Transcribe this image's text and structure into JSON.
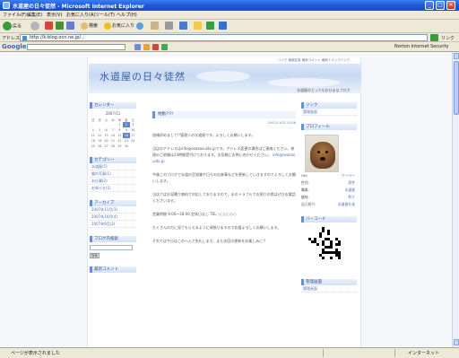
{
  "window": {
    "title": "水道屋の日々徒然 - Microsoft Internet Explorer"
  },
  "menu": [
    "ファイル(F)",
    "編集(E)",
    "表示(V)",
    "お気に入り(A)",
    "ツール(T)",
    "ヘルプ(H)"
  ],
  "toolbar": {
    "back": "戻る",
    "search": "検索",
    "favorites": "お気に入り"
  },
  "address": {
    "label": "アドレス(D)",
    "url": "http://k-blog.ocn.ne.jp/...",
    "links": "リンク"
  },
  "googlebar": {
    "logo": "Google",
    "norton": "Norton Internet Security"
  },
  "blog": {
    "title": "水道屋の日々徒然",
    "tagline": "水道屋のとってもおひまなブログ",
    "header_links": "リンク 最新記事 最新コメント 最新トラックバック",
    "left": {
      "calendar_heading": "カレンダー",
      "calendar_month": "2007/11",
      "calendar_weekdays": [
        "日",
        "月",
        "火",
        "水",
        "木",
        "金",
        "土"
      ],
      "calendar_rows": [
        [
          "",
          "",
          "",
          "",
          "1",
          "2",
          "3"
        ],
        [
          "4",
          "5",
          "6",
          "7",
          "8",
          "9",
          "10"
        ],
        [
          "11",
          "12",
          "13",
          "14",
          "15",
          "16",
          "17"
        ],
        [
          "18",
          "19",
          "20",
          "21",
          "22",
          "23",
          "24"
        ],
        [
          "25",
          "26",
          "27",
          "28",
          "29",
          "30",
          ""
        ]
      ],
      "categories_heading": "カテゴリー",
      "categories": [
        "水道屋(5)",
        "猫の写真(1)",
        "お仕事(2)",
        "お知らせ(1)"
      ],
      "archives_heading": "アーカイブ",
      "archives": [
        "2007年11月(3)",
        "2007年10月(4)",
        "2007年9月(2)"
      ],
      "search_heading": "ブログ内検索",
      "search_button": "検索",
      "recent_comments_heading": "最新コメント"
    },
    "post": {
      "title": "始動?!?!",
      "date": "2007/11/02 13:06",
      "paragraphs": [
        "皆様初めまして!!管理人の水道屋です。よろしくお願いします。",
        "当店のアドレスはinfo@osakasuido.jpです。アドレス変更の場合はご連絡ください。修理のご依頼は24時間受付けております。お気軽にお問い合わせください。",
        "今後このブログで水道の豆知識や日々の出来事などを更新していきますのでよろしくお願いします。",
        "当店ではお見積り無料で対応しておりますので、水のトラブルでお困りの際はぜひお電話くださいませ。",
        "営業時間 9:00〜18:00 定休日なし TEL ○○○○○○",
        "たくさんの方に見てもらえるように頑張りますので応援よろしくお願いします。",
        "それでは今日はこのへんで失礼します。また次回の更新をお楽しみに!!"
      ],
      "email_link": "info@osakasuido.jp"
    },
    "right": {
      "links_heading": "リンク",
      "links_item": "管理画面",
      "profile_heading": "プロフィール",
      "profile_rows": [
        {
          "k": "HN:",
          "v": "りーべー"
        },
        {
          "k": "性別:",
          "v": "男性"
        },
        {
          "k": "職業:",
          "v": "水道屋"
        },
        {
          "k": "趣味:",
          "v": "釣り"
        },
        {
          "k": "自己紹介:",
          "v": "水道屋社長"
        }
      ],
      "barcode_heading": "バーコード",
      "admin_heading": "管理画面",
      "admin_item": "管理画面"
    }
  },
  "status": {
    "left": "ページが表示されました",
    "zone": "インターネット"
  },
  "colors": {
    "xp_blue": "#1b55d6",
    "sidebar_accent": "#6a8fcf",
    "link": "#4b6cb3"
  }
}
